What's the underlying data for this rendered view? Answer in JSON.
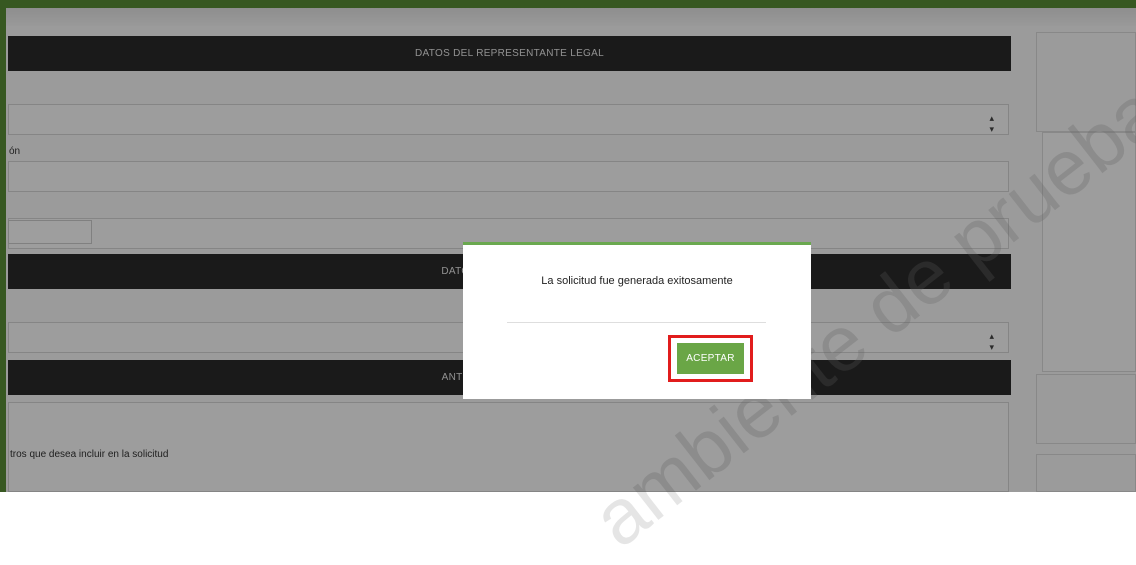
{
  "sections": {
    "legal_rep": "DATOS DEL REPRESENTANTE LEGAL",
    "obligation": "DATOS DE LA OBLIGACIÓN",
    "advances": "ANTICIPOS REGISTRADOS"
  },
  "labels": {
    "field_label_partial": "ón",
    "records_label": "tros que desea incluir en la solicitud"
  },
  "watermark_text": "ambiente de pruebas",
  "modal": {
    "message": "La solicitud fue generada exitosamente",
    "accept_label": "ACEPTAR"
  },
  "colors": {
    "frame_green": "#5a8f36",
    "button_green": "#6aa646",
    "highlight_red": "#e11c1c",
    "section_bar": "#2b2b2b"
  }
}
